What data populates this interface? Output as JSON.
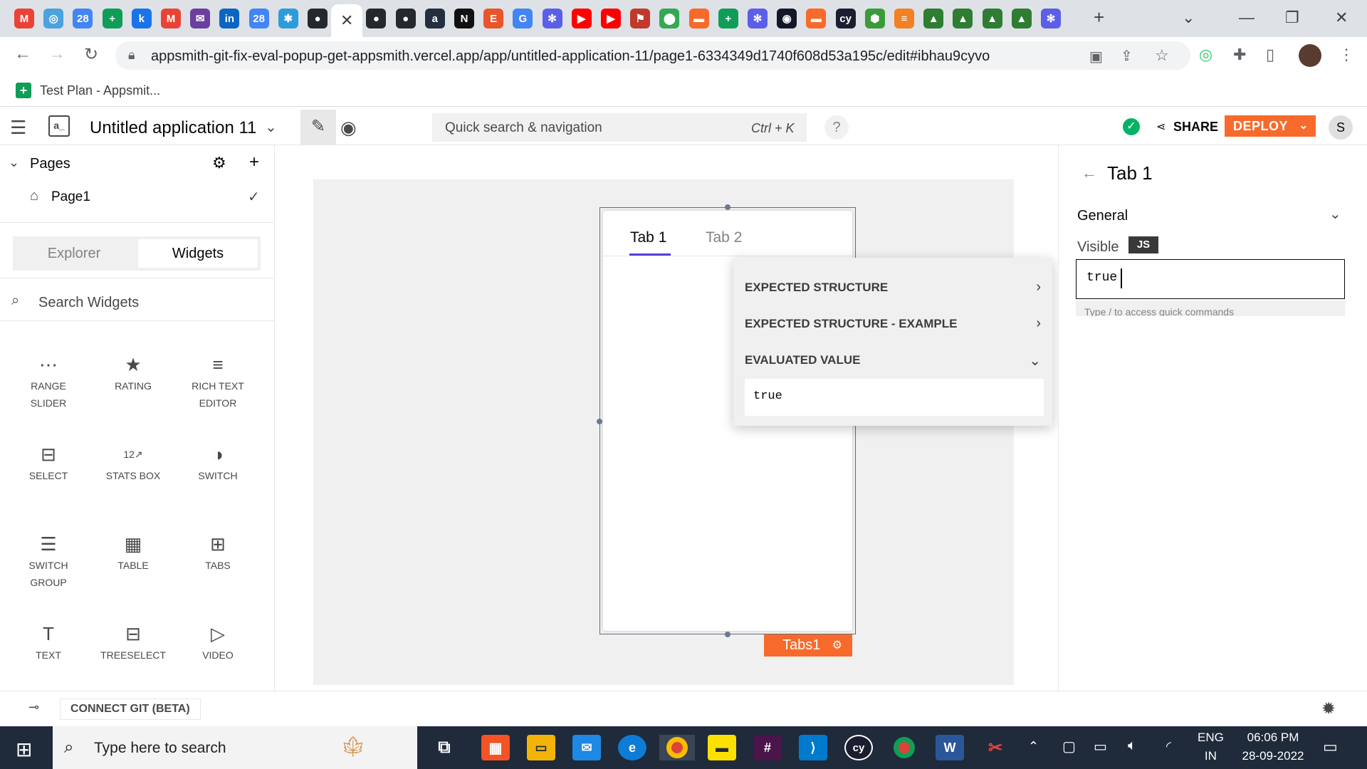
{
  "browser": {
    "tabs": [
      {
        "icon": "gmail-icon",
        "glyph": "M",
        "color": "#ea4335"
      },
      {
        "icon": "app-icon",
        "glyph": "◎",
        "color": "#4aa3df"
      },
      {
        "icon": "calendar-icon",
        "glyph": "28",
        "color": "#4285f4"
      },
      {
        "icon": "sheets-icon",
        "glyph": "+",
        "color": "#0f9d58"
      },
      {
        "icon": "k-icon",
        "glyph": "k",
        "color": "#1a73e8"
      },
      {
        "icon": "gmail-icon",
        "glyph": "M",
        "color": "#ea4335"
      },
      {
        "icon": "mail-icon",
        "glyph": "✉",
        "color": "#6b3fa0"
      },
      {
        "icon": "linkedin-icon",
        "glyph": "in",
        "color": "#0a66c2"
      },
      {
        "icon": "calendar-icon",
        "glyph": "28",
        "color": "#4285f4"
      },
      {
        "icon": "asterisk-icon",
        "glyph": "✱",
        "color": "#2d9cdb"
      },
      {
        "icon": "github-icon",
        "glyph": "●",
        "color": "#24292e"
      },
      {
        "icon": "close-icon",
        "glyph": "✕",
        "color": "#3c4043",
        "active": true
      },
      {
        "icon": "github-icon",
        "glyph": "●",
        "color": "#24292e"
      },
      {
        "icon": "github-icon",
        "glyph": "●",
        "color": "#24292e"
      },
      {
        "icon": "amazon-icon",
        "glyph": "a",
        "color": "#232f3e"
      },
      {
        "icon": "notion-icon",
        "glyph": "N",
        "color": "#111111"
      },
      {
        "icon": "e-icon",
        "glyph": "E",
        "color": "#e8552b"
      },
      {
        "icon": "google-icon",
        "glyph": "G",
        "color": "#4285f4"
      },
      {
        "icon": "asterisk-icon",
        "glyph": "✻",
        "color": "#5b5fe8"
      },
      {
        "icon": "youtube-icon",
        "glyph": "▶",
        "color": "#ff0000"
      },
      {
        "icon": "youtube-icon",
        "glyph": "▶",
        "color": "#ff0000"
      },
      {
        "icon": "app-icon",
        "glyph": "⚑",
        "color": "#c0392b"
      },
      {
        "icon": "maps-icon",
        "glyph": "⬤",
        "color": "#34a853"
      },
      {
        "icon": "app-icon",
        "glyph": "▬",
        "color": "#f86a2b"
      },
      {
        "icon": "sheets-icon",
        "glyph": "+",
        "color": "#0f9d58"
      },
      {
        "icon": "asterisk-icon",
        "glyph": "✻",
        "color": "#5b5fe8"
      },
      {
        "icon": "app-icon",
        "glyph": "◉",
        "color": "#111827"
      },
      {
        "icon": "app-icon",
        "glyph": "▬",
        "color": "#f86a2b"
      },
      {
        "icon": "cypress-icon",
        "glyph": "cy",
        "color": "#1b1e2e"
      },
      {
        "icon": "hex-icon",
        "glyph": "⬢",
        "color": "#3a9b3a"
      },
      {
        "icon": "stack-icon",
        "glyph": "≡",
        "color": "#f48024"
      },
      {
        "icon": "triangle-icon",
        "glyph": "▲",
        "color": "#2e7d32"
      },
      {
        "icon": "triangle-icon",
        "glyph": "▲",
        "color": "#2e7d32"
      },
      {
        "icon": "triangle-icon",
        "glyph": "▲",
        "color": "#2e7d32"
      },
      {
        "icon": "triangle-icon",
        "glyph": "▲",
        "color": "#2e7d32"
      },
      {
        "icon": "asterisk-icon",
        "glyph": "✻",
        "color": "#5b5fe8"
      }
    ],
    "url": "appsmith-git-fix-eval-popup-get-appsmith.vercel.app/app/untitled-application-11/page1-6334349d1740f608d53a195c/edit#ibhau9cyvo",
    "bookmark": "Test Plan - Appsmit..."
  },
  "app": {
    "name": "Untitled application 11",
    "logo": "a_",
    "search_placeholder": "Quick search & navigation",
    "search_shortcut": "Ctrl + K",
    "help": "?",
    "share": "SHARE",
    "deploy": "DEPLOY",
    "avatar": "S"
  },
  "leftpane": {
    "pages_label": "Pages",
    "page1": "Page1",
    "tab_explorer": "Explorer",
    "tab_widgets": "Widgets",
    "search_placeholder": "Search Widgets",
    "widgets": [
      {
        "name": "widget-range-slider",
        "icon": "range-slider-icon",
        "glyph": "⋯",
        "l1": "RANGE",
        "l2": "SLIDER"
      },
      {
        "name": "widget-rating",
        "icon": "star-icon",
        "glyph": "★",
        "l1": "RATING",
        "l2": ""
      },
      {
        "name": "widget-rich-text-editor",
        "icon": "align-left-icon",
        "glyph": "≡",
        "l1": "RICH TEXT",
        "l2": "EDITOR"
      },
      {
        "name": "widget-select",
        "icon": "select-icon",
        "glyph": "⊟",
        "l1": "SELECT",
        "l2": ""
      },
      {
        "name": "widget-stats-box",
        "icon": "stats-box-icon",
        "glyph": "12↗",
        "l1": "STATS BOX",
        "l2": ""
      },
      {
        "name": "widget-switch",
        "icon": "toggle-icon",
        "glyph": "◑",
        "l1": "SWITCH",
        "l2": ""
      },
      {
        "name": "widget-switch-group",
        "icon": "switch-group-icon",
        "glyph": "☰",
        "l1": "SWITCH",
        "l2": "GROUP"
      },
      {
        "name": "widget-table",
        "icon": "table-icon",
        "glyph": "▦",
        "l1": "TABLE",
        "l2": ""
      },
      {
        "name": "widget-tabs",
        "icon": "tabs-icon",
        "glyph": "⊞",
        "l1": "TABS",
        "l2": ""
      },
      {
        "name": "widget-text",
        "icon": "text-icon",
        "glyph": "T",
        "l1": "TEXT",
        "l2": ""
      },
      {
        "name": "widget-treeselect",
        "icon": "treeselect-icon",
        "glyph": "⊟",
        "l1": "TREESELECT",
        "l2": ""
      },
      {
        "name": "widget-video",
        "icon": "video-icon",
        "glyph": "▷",
        "l1": "VIDEO",
        "l2": ""
      }
    ]
  },
  "canvas": {
    "tab1": "Tab 1",
    "tab2": "Tab 2",
    "widget_label": "Tabs1"
  },
  "eval_popup": {
    "expected_structure": "EXPECTED STRUCTURE",
    "expected_structure_example": "EXPECTED STRUCTURE - EXAMPLE",
    "evaluated_value": "EVALUATED VALUE",
    "value": "true"
  },
  "rightpane": {
    "title": "Tab 1",
    "section": "General",
    "visible_label": "Visible",
    "js_badge": "JS",
    "visible_value": "true",
    "hint": "Type / to access quick commands"
  },
  "bottombar": {
    "connect_git": "CONNECT GIT (BETA)"
  },
  "taskbar": {
    "search_placeholder": "Type here to search",
    "lang1": "ENG",
    "lang2": "IN",
    "time": "06:06 PM",
    "date": "28-09-2022"
  },
  "colors": {
    "accent": "#f86a2b",
    "tab_underline": "#5b3fd6",
    "success": "#03b365"
  }
}
